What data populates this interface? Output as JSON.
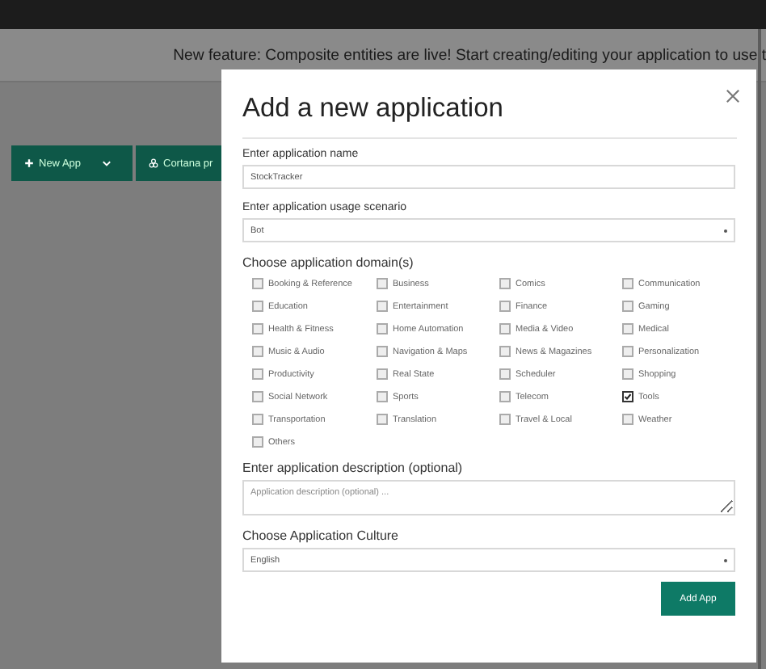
{
  "banner": {
    "text": "New feature: Composite entities are live! Start creating/editing your application to use t"
  },
  "toolbar": {
    "buttons": [
      {
        "kind": "new",
        "label": "New App"
      },
      {
        "kind": "cortana",
        "label": "Cortana pr"
      }
    ]
  },
  "dialog": {
    "title": "Add a new application",
    "name": {
      "label": "Enter application name",
      "value": "StockTracker"
    },
    "scenario": {
      "label": "Enter application usage scenario",
      "value": "Bot"
    },
    "domains_label": "Choose application domain(s)",
    "domains": [
      {
        "label": "Booking & Reference",
        "checked": false
      },
      {
        "label": "Business",
        "checked": false
      },
      {
        "label": "Comics",
        "checked": false
      },
      {
        "label": "Communication",
        "checked": false
      },
      {
        "label": "Education",
        "checked": false
      },
      {
        "label": "Entertainment",
        "checked": false
      },
      {
        "label": "Finance",
        "checked": false
      },
      {
        "label": "Gaming",
        "checked": false
      },
      {
        "label": "Health & Fitness",
        "checked": false
      },
      {
        "label": "Home Automation",
        "checked": false
      },
      {
        "label": "Media & Video",
        "checked": false
      },
      {
        "label": "Medical",
        "checked": false
      },
      {
        "label": "Music & Audio",
        "checked": false
      },
      {
        "label": "Navigation & Maps",
        "checked": false
      },
      {
        "label": "News & Magazines",
        "checked": false
      },
      {
        "label": "Personalization",
        "checked": false
      },
      {
        "label": "Productivity",
        "checked": false
      },
      {
        "label": "Real State",
        "checked": false
      },
      {
        "label": "Scheduler",
        "checked": false
      },
      {
        "label": "Shopping",
        "checked": false
      },
      {
        "label": "Social Network",
        "checked": false
      },
      {
        "label": "Sports",
        "checked": false
      },
      {
        "label": "Telecom",
        "checked": false
      },
      {
        "label": "Tools",
        "checked": true
      },
      {
        "label": "Transportation",
        "checked": false
      },
      {
        "label": "Translation",
        "checked": false
      },
      {
        "label": "Travel & Local",
        "checked": false
      },
      {
        "label": "Weather",
        "checked": false
      },
      {
        "label": "Others",
        "checked": false
      }
    ],
    "description": {
      "label": "Enter application description (optional)",
      "placeholder": "Application description (optional) ..."
    },
    "culture": {
      "label": "Choose Application Culture",
      "value": "English"
    },
    "submit": "Add App"
  }
}
